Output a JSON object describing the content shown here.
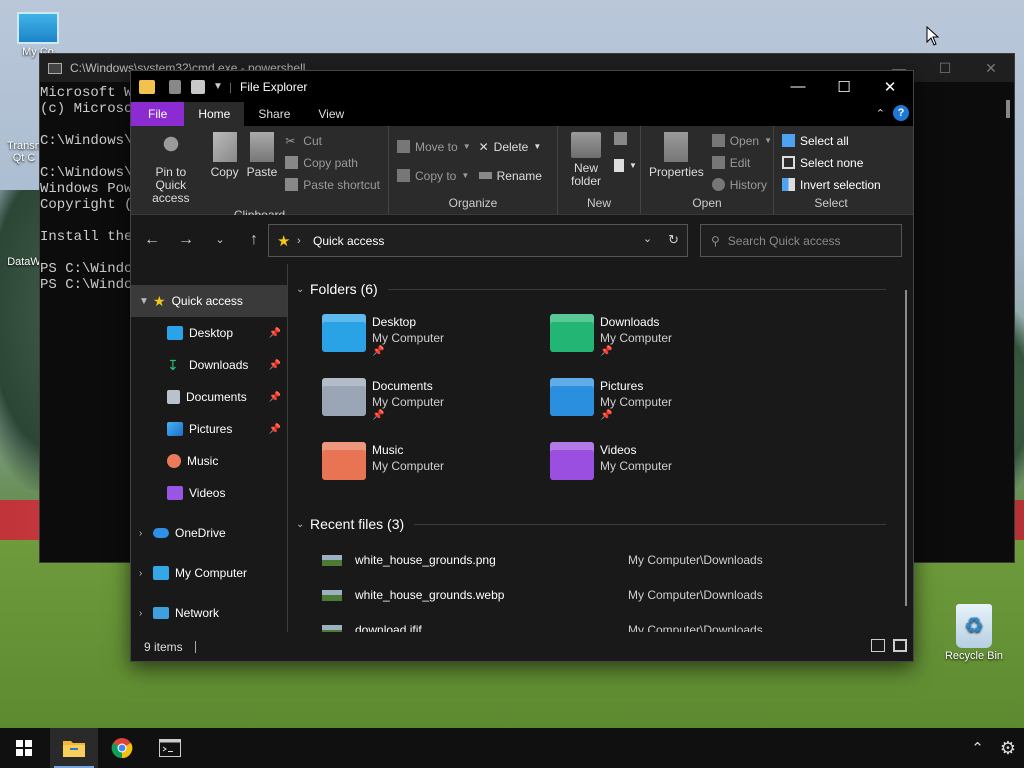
{
  "desktop": {
    "icons": {
      "my_computer": "My Co",
      "transmission": "Transn",
      "transmission_line2": "Qt C",
      "datawrangler": "DataW",
      "recycle_bin": "Recycle Bin"
    }
  },
  "terminal": {
    "title": "C:\\Windows\\system32\\cmd.exe - powershell",
    "lines": [
      "Microsoft W",
      "(c) Microso",
      "",
      "C:\\Windows\\s",
      "",
      "C:\\Windows\\s",
      "Windows Powe",
      "Copyright (",
      "",
      "Install the",
      "",
      "PS C:\\Windo",
      "PS C:\\Windo"
    ]
  },
  "explorer": {
    "title": "File Explorer",
    "tabs": {
      "file": "File",
      "home": "Home",
      "share": "Share",
      "view": "View"
    },
    "ribbon": {
      "clipboard": {
        "pin": "Pin to Quick access",
        "copy": "Copy",
        "paste": "Paste",
        "cut": "Cut",
        "copy_path": "Copy path",
        "paste_shortcut": "Paste shortcut",
        "label": "Clipboard"
      },
      "organize": {
        "move_to": "Move to",
        "copy_to": "Copy to",
        "delete": "Delete",
        "rename": "Rename",
        "label": "Organize"
      },
      "new": {
        "new_folder": "New folder",
        "label": "New"
      },
      "open": {
        "properties": "Properties",
        "open": "Open",
        "edit": "Edit",
        "history": "History",
        "label": "Open"
      },
      "select": {
        "select_all": "Select all",
        "select_none": "Select none",
        "invert": "Invert selection",
        "label": "Select"
      }
    },
    "address": {
      "crumb": "Quick access"
    },
    "search": {
      "placeholder": "Search Quick access"
    },
    "sidebar": {
      "quick_access": "Quick access",
      "desktop": "Desktop",
      "downloads": "Downloads",
      "documents": "Documents",
      "pictures": "Pictures",
      "music": "Music",
      "videos": "Videos",
      "onedrive": "OneDrive",
      "my_computer": "My Computer",
      "network": "Network"
    },
    "folders_header": "Folders (6)",
    "folders": [
      {
        "name": "Desktop",
        "location": "My Computer",
        "color": "#29a3e6"
      },
      {
        "name": "Downloads",
        "location": "My Computer",
        "color": "#22b573"
      },
      {
        "name": "Documents",
        "location": "My Computer",
        "color": "#9aa6b5"
      },
      {
        "name": "Pictures",
        "location": "My Computer",
        "color": "#2b8fe0"
      },
      {
        "name": "Music",
        "location": "My Computer",
        "color": "#e87454"
      },
      {
        "name": "Videos",
        "location": "My Computer",
        "color": "#9a4fe0"
      }
    ],
    "recent_header": "Recent files (3)",
    "recent": [
      {
        "name": "white_house_grounds.png",
        "path": "My Computer\\Downloads"
      },
      {
        "name": "white_house_grounds.webp",
        "path": "My Computer\\Downloads"
      },
      {
        "name": "download.jfif",
        "path": "My Computer\\Downloads"
      }
    ],
    "status": "9 items"
  }
}
